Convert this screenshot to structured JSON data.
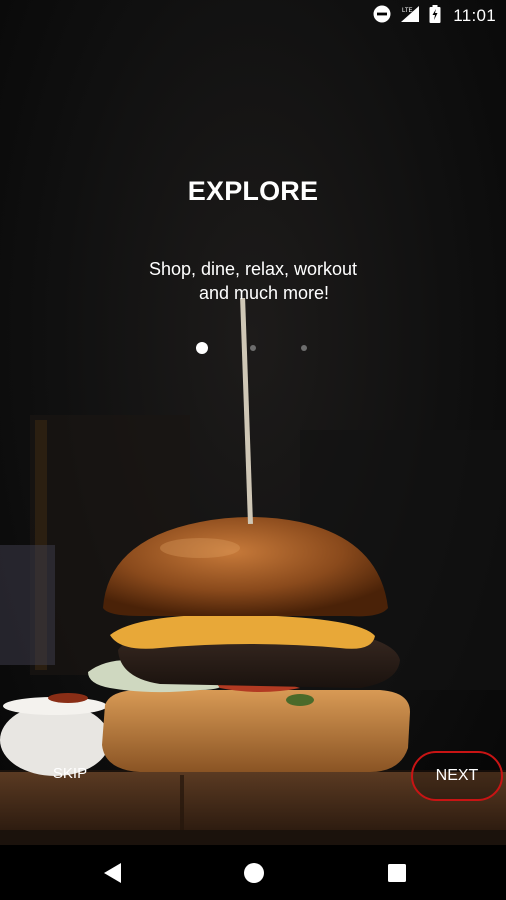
{
  "status_bar": {
    "time": "11:01",
    "network_label": "LTE",
    "icons": [
      "do-not-disturb-icon",
      "cell-signal-icon",
      "battery-charging-icon"
    ]
  },
  "onboarding": {
    "title": "EXPLORE",
    "subtitle_line1": "Shop, dine, relax, workout",
    "subtitle_line2": "and much more!",
    "page_indicator": {
      "current_page": 1,
      "total_pages": 3
    },
    "skip_label": "SKIP",
    "next_label": "NEXT",
    "background_image": "burger-photo"
  },
  "navigation_bar": {
    "icons": [
      "back-icon",
      "home-icon",
      "recents-icon"
    ]
  },
  "colors": {
    "next_button_border": "#c81414",
    "text": "#ffffff",
    "inactive_dot": "#6d6d6d"
  }
}
